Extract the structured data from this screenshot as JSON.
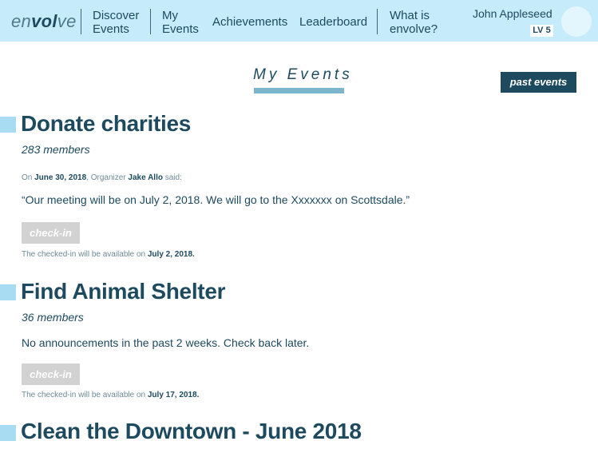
{
  "app": {
    "logo_prefix": "en",
    "logo_bold": "vol",
    "logo_suffix": "ve"
  },
  "nav": {
    "discover_line1": "Discover",
    "discover_line2": "Events",
    "my_line1": "My",
    "my_line2": "Events",
    "achievements": "Achievements",
    "leaderboard": "Leaderboard",
    "what_line1": "What is",
    "what_line2": "envolve?"
  },
  "user": {
    "name": "John Appleseed",
    "level": "LV 5"
  },
  "page": {
    "title": "My Events",
    "past_events_label": "past events"
  },
  "events": [
    {
      "title": "Donate charities",
      "members": "283 members",
      "meta_on": "On",
      "meta_date": "June 30, 2018",
      "meta_org": ", Organizer",
      "meta_organizer": "Jake Allo",
      "meta_said": "said:",
      "announcement": "“Our meeting will be on July 2, 2018. We will go to the Xxxxxxx on Scottsdale.”",
      "checkin_label": "check-in",
      "available_text": "The checked-in will be available on",
      "available_date": "July 2, 2018."
    },
    {
      "title": "Find Animal Shelter",
      "members": "36 members",
      "announcement": "No announcements in the past 2 weeks. Check back later.",
      "checkin_label": "check-in",
      "available_text": "The checked-in will be available on",
      "available_date": "July 17, 2018."
    },
    {
      "title": "Clean the Downtown - June 2018"
    }
  ],
  "colors": {
    "nav_bg": "#c6ecfb",
    "primary": "#1d4a5e",
    "accent": "#7cb6cc",
    "marker": "#a8dcf2",
    "checkin_disabled": "#d2d2d2"
  }
}
